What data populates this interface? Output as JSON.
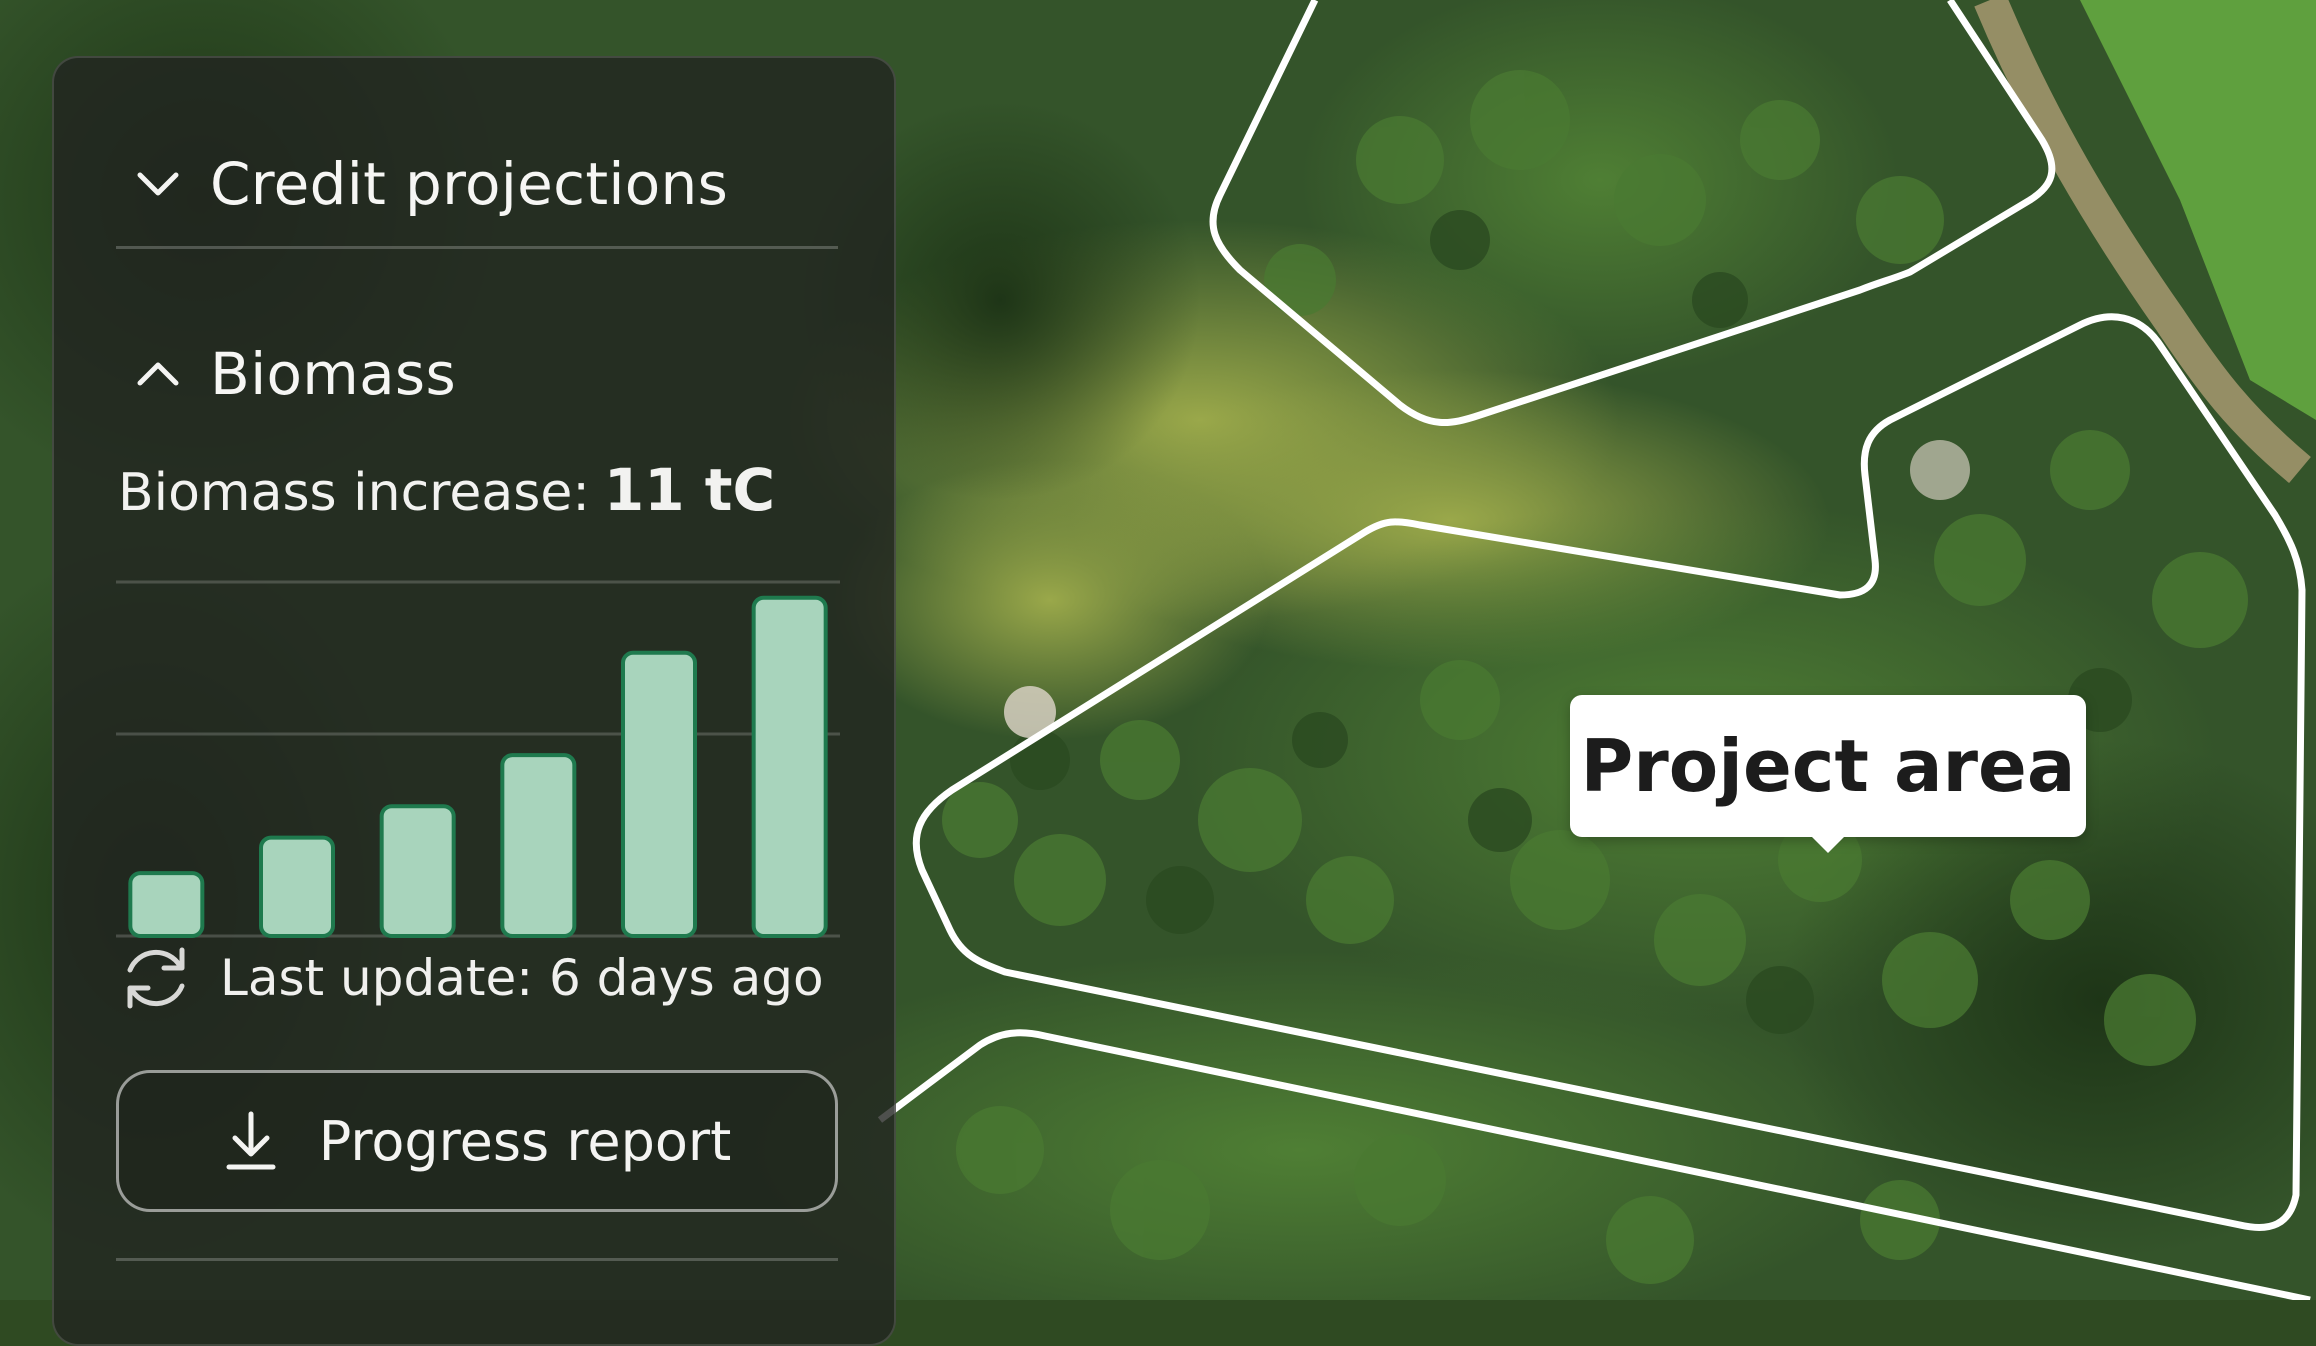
{
  "map": {
    "area_label": "Project area",
    "colors": {
      "forest": "#2f4a22",
      "canopy": "#3d6a2c",
      "meadow": "#8a9a3c",
      "field": "#5fa03e",
      "boundary": "#ffffff"
    }
  },
  "panel": {
    "credit_section": {
      "label": "Credit projections",
      "state": "collapsed"
    },
    "biomass_section": {
      "label": "Biomass",
      "state": "expanded"
    },
    "increase": {
      "label": "Biomass increase:",
      "value": "11 tC"
    },
    "last_update": "Last update: 6 days ago",
    "report_button": "Progress report",
    "icons": {
      "collapsed": "chevron-down-icon",
      "expanded": "chevron-up-icon",
      "update": "refresh-icon",
      "download": "download-icon"
    }
  },
  "chart_data": {
    "type": "bar",
    "categories": [
      "",
      "",
      "",
      "",
      "",
      ""
    ],
    "values": [
      1.6,
      2.5,
      3.3,
      4.6,
      7.2,
      8.6
    ],
    "ylim": [
      0,
      9
    ],
    "grid": true,
    "colors": {
      "bar_fill": "#a8d4bc",
      "bar_stroke": "#1f7a4e"
    }
  }
}
